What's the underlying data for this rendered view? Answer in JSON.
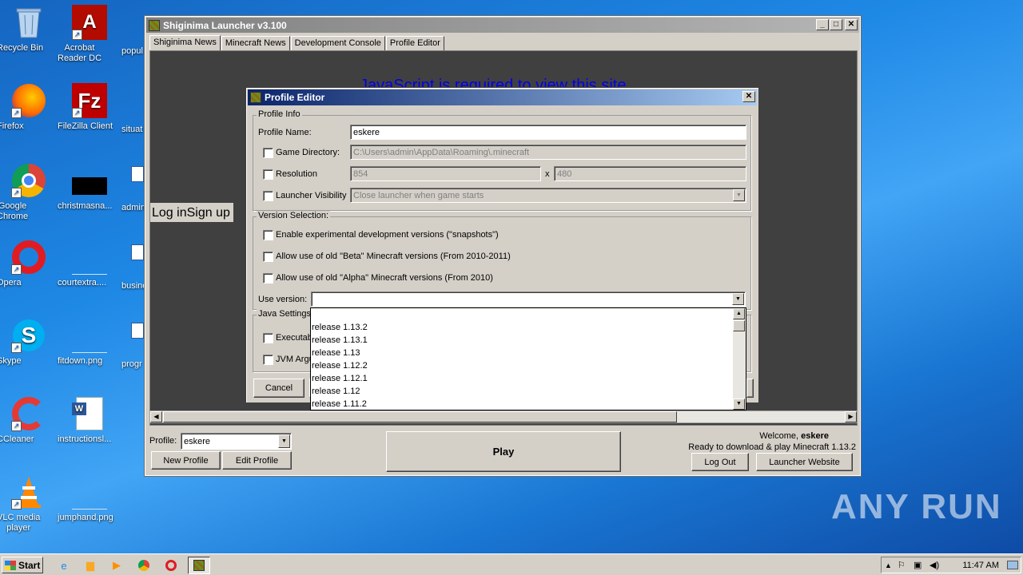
{
  "desktop": {
    "icons": [
      {
        "label": "Recycle Bin"
      },
      {
        "label": "Acrobat\nReader DC"
      },
      {
        "label": "Firefox"
      },
      {
        "label": "FileZilla Client"
      },
      {
        "label": "Google\nChrome"
      },
      {
        "label": "christmasna..."
      },
      {
        "label": "Opera"
      },
      {
        "label": "courtextra...."
      },
      {
        "label": "Skype"
      },
      {
        "label": "fitdown.png"
      },
      {
        "label": "CCleaner"
      },
      {
        "label": "instructionsl..."
      },
      {
        "label": "VLC media\nplayer"
      },
      {
        "label": "jumphand.png"
      }
    ],
    "partial_labels": [
      "popul",
      "situat",
      "admin",
      "busine",
      "progr"
    ]
  },
  "launcher": {
    "title": "Shiginima Launcher v3.100",
    "tabs": [
      "Shiginima News",
      "Minecraft News",
      "Development Console",
      "Profile Editor"
    ],
    "js_message": "JavaScript is required to view this site.",
    "login_text": "Log inSign up",
    "profile_label": "Profile:",
    "profile_value": "eskere",
    "new_profile": "New Profile",
    "edit_profile": "Edit Profile",
    "play": "Play",
    "welcome_prefix": "Welcome,",
    "welcome_user": "eskere",
    "status": "Ready to download & play Minecraft 1.13.2",
    "log_out": "Log Out",
    "launcher_website": "Launcher Website"
  },
  "profile_editor": {
    "title": "Profile Editor",
    "profile_info": "Profile Info",
    "profile_name_label": "Profile Name:",
    "profile_name_value": "eskere",
    "game_dir_label": "Game Directory:",
    "game_dir_value": "C:\\Users\\admin\\AppData\\Roaming\\.minecraft",
    "resolution_label": "Resolution",
    "res_width": "854",
    "res_x": "x",
    "res_height": "480",
    "launcher_visibility_label": "Launcher Visibility",
    "launcher_visibility_value": "Close launcher when game starts",
    "version_selection": "Version Selection:",
    "snapshots": "Enable experimental development versions (\"snapshots\")",
    "beta": "Allow use of old \"Beta\" Minecraft versions (From 2010-2011)",
    "alpha": "Allow use of old \"Alpha\" Minecraft versions (From 2010)",
    "use_version_label": "Use version:",
    "use_version_value": "",
    "java_settings": "Java Settings",
    "executable_label": "Executab",
    "jvm_label": "JVM Argu",
    "cancel": "Cancel",
    "versions": [
      "",
      "release 1.13.2",
      "release 1.13.1",
      "release 1.13",
      "release 1.12.2",
      "release 1.12.1",
      "release 1.12",
      "release 1.11.2"
    ]
  },
  "watermark": "ANY RUN",
  "taskbar": {
    "start": "Start",
    "clock": "11:47 AM"
  }
}
